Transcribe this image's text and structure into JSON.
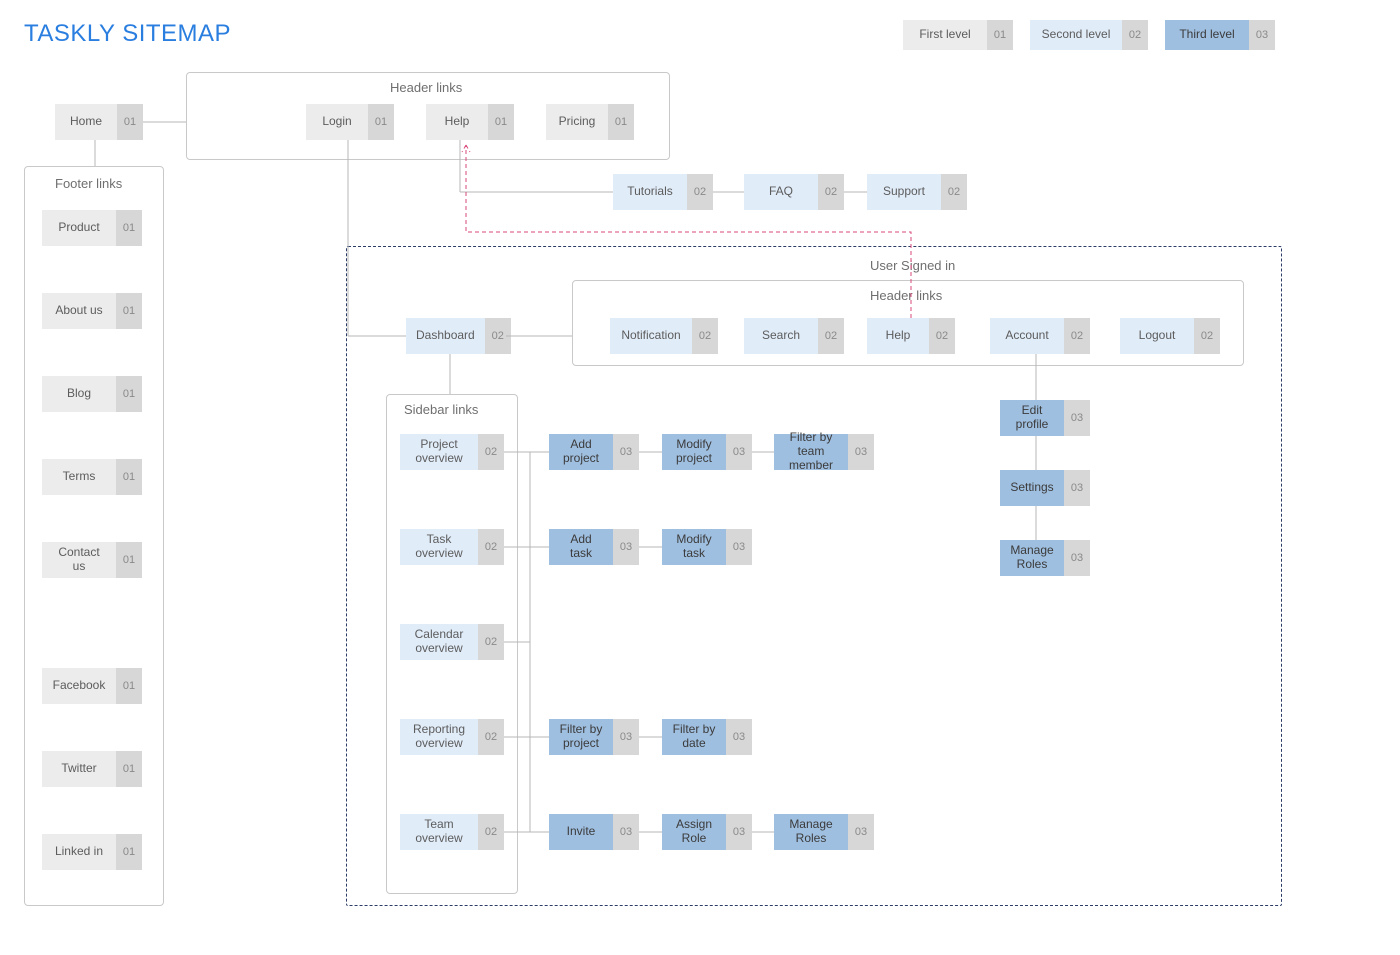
{
  "title": "TASKLY SITEMAP",
  "legend": {
    "first": {
      "label": "First level",
      "num": "01"
    },
    "second": {
      "label": "Second level",
      "num": "02"
    },
    "third": {
      "label": "Third level",
      "num": "03"
    }
  },
  "home": {
    "label": "Home",
    "num": "01"
  },
  "header_group_title": "Header links",
  "header": {
    "login": {
      "label": "Login",
      "num": "01"
    },
    "help": {
      "label": "Help",
      "num": "01"
    },
    "pricing": {
      "label": "Pricing",
      "num": "01"
    }
  },
  "help_children": {
    "tutorials": {
      "label": "Tutorials",
      "num": "02"
    },
    "faq": {
      "label": "FAQ",
      "num": "02"
    },
    "support": {
      "label": "Support",
      "num": "02"
    }
  },
  "footer_group_title": "Footer links",
  "footer": {
    "product": {
      "label": "Product",
      "num": "01"
    },
    "about": {
      "label": "About us",
      "num": "01"
    },
    "blog": {
      "label": "Blog",
      "num": "01"
    },
    "terms": {
      "label": "Terms",
      "num": "01"
    },
    "contact": {
      "label": "Contact us",
      "num": "01"
    },
    "facebook": {
      "label": "Facebook",
      "num": "01"
    },
    "twitter": {
      "label": "Twitter",
      "num": "01"
    },
    "linkedin": {
      "label": "Linked in",
      "num": "01"
    }
  },
  "signed_in_title": "User Signed in",
  "signed_header_title": "Header links",
  "dashboard": {
    "label": "Dashboard",
    "num": "02"
  },
  "signed_header": {
    "notification": {
      "label": "Notification",
      "num": "02"
    },
    "search": {
      "label": "Search",
      "num": "02"
    },
    "help": {
      "label": "Help",
      "num": "02"
    },
    "account": {
      "label": "Account",
      "num": "02"
    },
    "logout": {
      "label": "Logout",
      "num": "02"
    }
  },
  "account_children": {
    "edit_profile": {
      "label": "Edit profile",
      "num": "03"
    },
    "settings": {
      "label": "Settings",
      "num": "03"
    },
    "manage_roles": {
      "label": "Manage Roles",
      "num": "03"
    }
  },
  "sidebar_group_title": "Sidebar links",
  "sidebar": {
    "project": {
      "label": "Project overview",
      "num": "02"
    },
    "task": {
      "label": "Task overview",
      "num": "02"
    },
    "calendar": {
      "label": "Calendar overview",
      "num": "02"
    },
    "reporting": {
      "label": "Reporting overview",
      "num": "02"
    },
    "team": {
      "label": "Team overview",
      "num": "02"
    }
  },
  "project_children": {
    "add": {
      "label": "Add project",
      "num": "03"
    },
    "modify": {
      "label": "Modify project",
      "num": "03"
    },
    "filter": {
      "label": "Filter by team member",
      "num": "03"
    }
  },
  "task_children": {
    "add": {
      "label": "Add task",
      "num": "03"
    },
    "modify": {
      "label": "Modify task",
      "num": "03"
    }
  },
  "reporting_children": {
    "byproject": {
      "label": "Filter by project",
      "num": "03"
    },
    "bydate": {
      "label": "Filter by date",
      "num": "03"
    }
  },
  "team_children": {
    "invite": {
      "label": "Invite",
      "num": "03"
    },
    "assign": {
      "label": "Assign Role",
      "num": "03"
    },
    "manage": {
      "label": "Manage Roles",
      "num": "03"
    }
  }
}
